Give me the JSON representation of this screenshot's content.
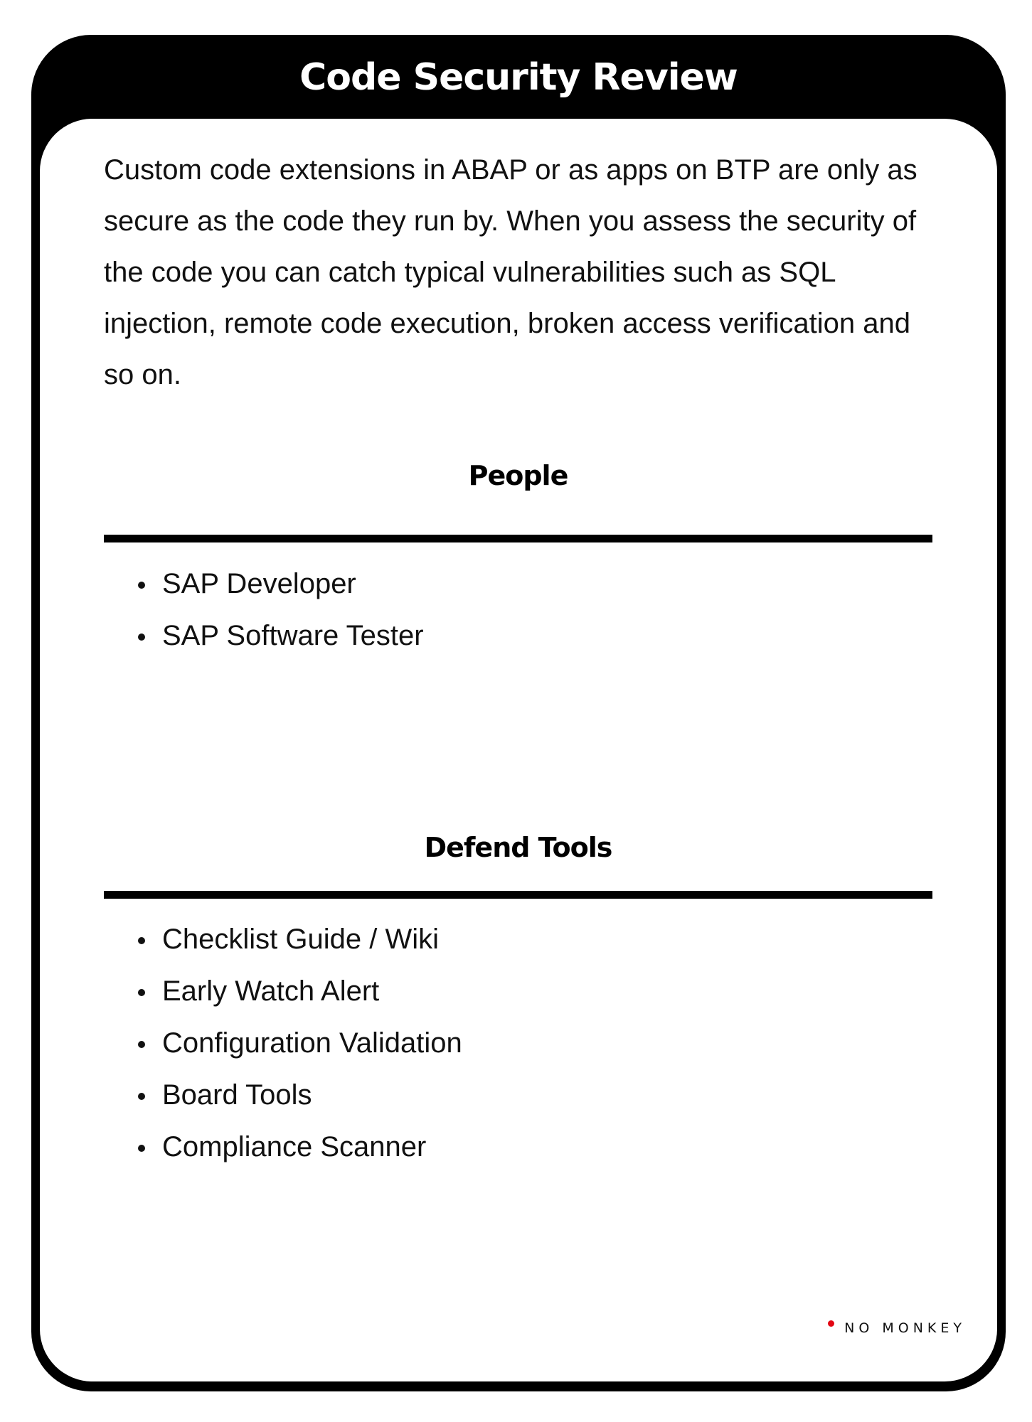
{
  "header": {
    "title": "Code Security Review"
  },
  "intro": {
    "text": "Custom code extensions in ABAP or as apps on BTP are only as secure as the code they run by. When you assess the security of the code you can catch typical vulnerabilities such as SQL injection, remote code execution, broken access verification and so on."
  },
  "people": {
    "title": "People",
    "items": [
      "SAP Developer",
      "SAP Software Tester"
    ]
  },
  "defend_tools": {
    "title": "Defend Tools",
    "items": [
      "Checklist Guide / Wiki",
      "Early Watch Alert",
      "Configuration Validation",
      "Board Tools",
      "Compliance Scanner"
    ]
  },
  "brand": {
    "name": "NO MONKEY",
    "accent_color": "#e30613"
  },
  "colors": {
    "frame": "#000000",
    "background": "#ffffff",
    "text": "#111111"
  }
}
